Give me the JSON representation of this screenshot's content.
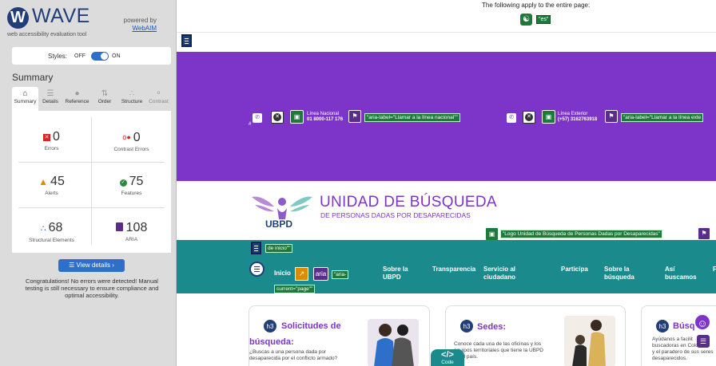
{
  "wave": {
    "logo_letter": "W",
    "name": "WAVE",
    "tagline": "web accessibility evaluation tool",
    "powered_by": "powered by",
    "webaim_link": "WebAIM",
    "styles_label": "Styles:",
    "styles_off": "OFF",
    "styles_on": "ON",
    "styles_on_state": true,
    "summary_title": "Summary",
    "tabs": [
      {
        "label": "Summary",
        "icon": "home-icon"
      },
      {
        "label": "Details",
        "icon": "list-icon"
      },
      {
        "label": "Reference",
        "icon": "info-icon"
      },
      {
        "label": "Order",
        "icon": "order-icon"
      },
      {
        "label": "Structure",
        "icon": "structure-icon"
      },
      {
        "label": "Contrast",
        "icon": "contrast-icon"
      }
    ],
    "stats": {
      "errors": {
        "value": "0",
        "label": "Errors"
      },
      "contrast_errors": {
        "value": "0",
        "label": "Contrast Errors"
      },
      "alerts": {
        "value": "45",
        "label": "Alerts"
      },
      "features": {
        "value": "75",
        "label": "Features"
      },
      "structural": {
        "value": "68",
        "label": "Structural Elements"
      },
      "aria": {
        "value": "108",
        "label": "ARIA"
      }
    },
    "view_details": "View details ›",
    "congrats": "Congratulations! No errors were detected! Manual testing is still necessary to ensure compliance and optimal accessibility."
  },
  "page": {
    "entire_page_text": "The following apply to the entire page:",
    "lang_tag": "\"es\"",
    "top_bar": {
      "linea_nacional": "Línea Nacional",
      "nacional_number": "01 8000-117 176",
      "nacional_aria": "\"aria-label=\"Llamar a la línea nacional\"\"",
      "linea_exterior": "Línea Exterior",
      "exterior_number": "(+57) 3162763918",
      "exterior_aria": "\"aria-label=\"Llamar a la línea exte"
    },
    "logo": {
      "short": "UBPD",
      "title": "UNIDAD DE BÚSQUEDA",
      "subtitle": "DE PERSONAS DADAS POR DESAPARECIDAS",
      "alt_tag": "\"Logo Unidad de Búsqueda de Personas Dadas por Desaparecidas\""
    },
    "nav": {
      "skip_tag": "de inicio\"\"",
      "inicio": "Inicio",
      "aria_label": "aria",
      "aria_current": "\"aria-",
      "aria_current_2": "current=\"page\"\"",
      "items": [
        {
          "line1": "Sobre la",
          "line2": "UBPD"
        },
        {
          "line1": "Transparencia",
          "line2": ""
        },
        {
          "line1": "Servicio al",
          "line2": "ciudadano"
        },
        {
          "line1": "Participa",
          "line2": ""
        },
        {
          "line1": "Sobre la",
          "line2": "búsqueda"
        },
        {
          "line1": "Así",
          "line2": "buscamos"
        }
      ]
    },
    "cards": [
      {
        "heading_tag": "h3",
        "title_1": "Solicitudes de",
        "title_2": "búsqueda:",
        "text_1": "¿Buscas a una persona dada por",
        "text_2": "desaparecida por el conflicto armado?"
      },
      {
        "heading_tag": "h3",
        "title_1": "Sedes:",
        "text_1": "Conoce cada una de las oficinas y los",
        "text_2": "equipos territoriales que tiene la UBPD",
        "text_3": "en el país."
      },
      {
        "heading_tag": "h3",
        "title_1": "Búsq",
        "text_1": "Ayúdanos a facilit",
        "text_2": "buscadoras en Colombia",
        "text_3": "y el paradero de sus seres",
        "text_4": "desaparecidos."
      }
    ],
    "code_tab": {
      "symbol": "</>",
      "label": "Code"
    }
  },
  "colors": {
    "wave_blue": "#213e78",
    "purple": "#7d35c9",
    "teal": "#1a8a8d",
    "green": "#1d7a3b"
  }
}
